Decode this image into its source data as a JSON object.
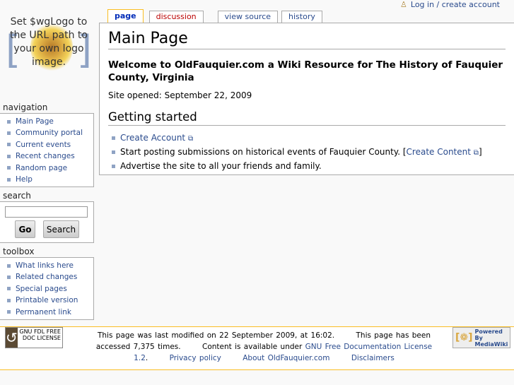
{
  "logo": {
    "text": "Set $wgLogo to the URL path to your own logo image."
  },
  "personal": {
    "login": "Log in / create account"
  },
  "tabs": [
    {
      "label": "page"
    },
    {
      "label": "discussion"
    },
    {
      "label": "view source"
    },
    {
      "label": "history"
    }
  ],
  "content": {
    "title": "Main Page",
    "welcome": "Welcome to OldFauquier.com a Wiki Resource for The History of Fauquier County, Virginia",
    "opened": "Site opened: September 22, 2009",
    "section": "Getting started",
    "list": {
      "item1_link": "Create Account",
      "item2_text": "Start posting submissions on historical events of Fauquier County. [",
      "item2_link": "Create Content",
      "item2_end": "]",
      "item3": "Advertise the site to all your friends and family."
    }
  },
  "navigation": {
    "title": "navigation",
    "items": [
      "Main Page",
      "Community portal",
      "Current events",
      "Recent changes",
      "Random page",
      "Help"
    ]
  },
  "search": {
    "title": "search",
    "value": "",
    "go": "Go",
    "search": "Search"
  },
  "toolbox": {
    "title": "toolbox",
    "items": [
      "What links here",
      "Related changes",
      "Special pages",
      "Printable version",
      "Permanent link"
    ]
  },
  "footer": {
    "gnu_badge": "GNU FDL FREE DOC LICENSE",
    "modified": "This page was last modified on 22 September 2009, at 16:02.",
    "accessed": "This page has been accessed 7,375 times.",
    "content_prefix": "Content is available under",
    "license_link": "GNU Free Documentation License 1.2",
    "privacy": "Privacy policy",
    "about": "About OldFauquier.com",
    "disclaimers": "Disclaimers",
    "powered": "Powered By MediaWiki"
  }
}
